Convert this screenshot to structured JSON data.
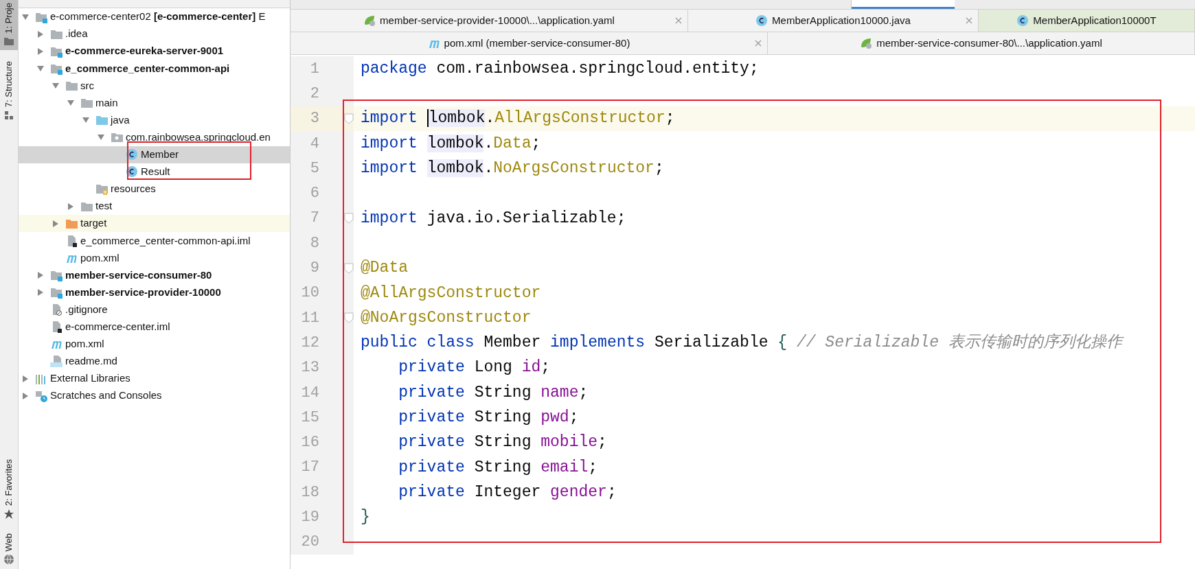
{
  "tool_stripe": [
    {
      "label": "1: Proje",
      "selected": true
    },
    {
      "label": "7: Structure",
      "selected": false
    },
    {
      "label": "2: Favorites",
      "selected": false
    },
    {
      "label": "Web",
      "selected": false
    }
  ],
  "project_tree": [
    {
      "label": "e-commerce-center02 **[e-commerce-center]** E",
      "kind": "project",
      "expanded": true,
      "selected": false,
      "children": [
        {
          "label": ".idea",
          "kind": "folder",
          "expanded": false,
          "selected": false
        },
        {
          "label": "e-commerce-eureka-server-9001",
          "kind": "module",
          "expanded": false,
          "selected": false
        },
        {
          "label": "e_commerce_center-common-api",
          "kind": "module",
          "expanded": true,
          "selected": false,
          "children": [
            {
              "label": "src",
              "kind": "folder",
              "expanded": true,
              "selected": false,
              "children": [
                {
                  "label": "main",
                  "kind": "folder",
                  "expanded": true,
                  "selected": false,
                  "children": [
                    {
                      "label": "java",
                      "kind": "source",
                      "expanded": true,
                      "selected": false,
                      "children": [
                        {
                          "label": "com.rainbowsea.springcloud.en",
                          "kind": "package",
                          "expanded": true,
                          "selected": false,
                          "children": [
                            {
                              "label": "Member",
                              "kind": "class",
                              "selected": true
                            },
                            {
                              "label": "Result",
                              "kind": "class",
                              "selected": false
                            }
                          ]
                        }
                      ]
                    },
                    {
                      "label": "resources",
                      "kind": "resources",
                      "selected": false
                    }
                  ]
                },
                {
                  "label": "test",
                  "kind": "folder",
                  "expanded": false,
                  "selected": false
                }
              ]
            },
            {
              "label": "target",
              "kind": "excluded",
              "expanded": false,
              "selected": false
            },
            {
              "label": "e_commerce_center-common-api.iml",
              "kind": "iml",
              "selected": false
            },
            {
              "label": "pom.xml",
              "kind": "maven",
              "selected": false
            }
          ]
        },
        {
          "label": "member-service-consumer-80",
          "kind": "module",
          "expanded": false,
          "selected": false
        },
        {
          "label": "member-service-provider-10000",
          "kind": "module",
          "expanded": false,
          "selected": false
        },
        {
          "label": ".gitignore",
          "kind": "gitignore",
          "selected": false
        },
        {
          "label": "e-commerce-center.iml",
          "kind": "iml",
          "selected": false
        },
        {
          "label": "pom.xml",
          "kind": "maven",
          "selected": false
        },
        {
          "label": "readme.md",
          "kind": "markdown",
          "selected": false
        }
      ]
    },
    {
      "label": "External Libraries",
      "kind": "libraries",
      "expanded": false,
      "selected": false
    },
    {
      "label": "Scratches and Consoles",
      "kind": "scratches",
      "expanded": false,
      "selected": false
    }
  ],
  "tab_rows": [
    {
      "tabs": [
        {
          "label": "member-service-provider-10000\\...\\application.yaml",
          "kind": "yaml",
          "closable": true,
          "tinted": false
        },
        {
          "label": "MemberApplication10000.java",
          "kind": "java",
          "closable": true,
          "tinted": false
        },
        {
          "label": "MemberApplication10000T",
          "kind": "java",
          "closable": false,
          "tinted": true
        }
      ]
    },
    {
      "tabs": [
        {
          "label": "pom.xml (member-service-consumer-80)",
          "kind": "maven",
          "closable": true,
          "tinted": false
        },
        {
          "label": "member-service-consumer-80\\...\\application.yaml",
          "kind": "yaml",
          "closable": false,
          "tinted": false
        }
      ]
    }
  ],
  "code": {
    "lines": [
      {
        "number": "1",
        "fold": false,
        "current": false,
        "tokens": [
          {
            "text": "package",
            "kind": "keyword"
          },
          {
            "text": " com.rainbowsea.springcloud.entity;",
            "kind": "plain"
          }
        ]
      },
      {
        "number": "2",
        "fold": false,
        "current": false
      },
      {
        "number": "3",
        "fold": true,
        "current": true,
        "tokens": [
          {
            "text": "import ",
            "kind": "keyword"
          },
          {
            "text": "lombok",
            "kind": "ref",
            "caret": true
          },
          {
            "text": ".",
            "kind": "plain"
          },
          {
            "text": "AllArgsConstructor",
            "kind": "annotation"
          },
          {
            "text": ";",
            "kind": "plain"
          }
        ]
      },
      {
        "number": "4",
        "fold": false,
        "current": false,
        "tokens": [
          {
            "text": "import ",
            "kind": "keyword"
          },
          {
            "text": "lombok",
            "kind": "ref"
          },
          {
            "text": ".",
            "kind": "plain"
          },
          {
            "text": "Data",
            "kind": "annotation"
          },
          {
            "text": ";",
            "kind": "plain"
          }
        ]
      },
      {
        "number": "5",
        "fold": false,
        "current": false,
        "tokens": [
          {
            "text": "import ",
            "kind": "keyword"
          },
          {
            "text": "lombok",
            "kind": "ref"
          },
          {
            "text": ".",
            "kind": "plain"
          },
          {
            "text": "NoArgsConstructor",
            "kind": "annotation"
          },
          {
            "text": ";",
            "kind": "plain"
          }
        ]
      },
      {
        "number": "6",
        "fold": false,
        "current": false
      },
      {
        "number": "7",
        "fold": true,
        "current": false,
        "tokens": [
          {
            "text": "import",
            "kind": "keyword"
          },
          {
            "text": " java.io.Serializable;",
            "kind": "plain"
          }
        ]
      },
      {
        "number": "8",
        "fold": false,
        "current": false
      },
      {
        "number": "9",
        "fold": true,
        "current": false,
        "tokens": [
          {
            "text": "@Data",
            "kind": "annotation"
          }
        ]
      },
      {
        "number": "10",
        "fold": false,
        "current": false,
        "tokens": [
          {
            "text": "@AllArgsConstructor",
            "kind": "annotation"
          }
        ]
      },
      {
        "number": "11",
        "fold": true,
        "current": false,
        "tokens": [
          {
            "text": "@NoArgsConstructor",
            "kind": "annotation"
          }
        ]
      },
      {
        "number": "12",
        "fold": false,
        "current": false,
        "tokens": [
          {
            "text": "public class",
            "kind": "keyword"
          },
          {
            "text": " Member ",
            "kind": "plain"
          },
          {
            "text": "implements",
            "kind": "keyword"
          },
          {
            "text": " Serializable ",
            "kind": "plain"
          },
          {
            "text": "{",
            "kind": "brace"
          },
          {
            "text": " // Serializable 表示传输时的序列化操作",
            "kind": "comment"
          }
        ]
      },
      {
        "number": "13",
        "fold": false,
        "current": false,
        "tokens": [
          {
            "text": "    private",
            "kind": "keyword"
          },
          {
            "text": " Long ",
            "kind": "plain"
          },
          {
            "text": "id",
            "kind": "field"
          },
          {
            "text": ";",
            "kind": "plain"
          }
        ]
      },
      {
        "number": "14",
        "fold": false,
        "current": false,
        "tokens": [
          {
            "text": "    private",
            "kind": "keyword"
          },
          {
            "text": " String ",
            "kind": "plain"
          },
          {
            "text": "name",
            "kind": "field"
          },
          {
            "text": ";",
            "kind": "plain"
          }
        ]
      },
      {
        "number": "15",
        "fold": false,
        "current": false,
        "tokens": [
          {
            "text": "    private",
            "kind": "keyword"
          },
          {
            "text": " String ",
            "kind": "plain"
          },
          {
            "text": "pwd",
            "kind": "field"
          },
          {
            "text": ";",
            "kind": "plain"
          }
        ]
      },
      {
        "number": "16",
        "fold": false,
        "current": false,
        "tokens": [
          {
            "text": "    private",
            "kind": "keyword"
          },
          {
            "text": " String ",
            "kind": "plain"
          },
          {
            "text": "mobile",
            "kind": "field"
          },
          {
            "text": ";",
            "kind": "plain"
          }
        ]
      },
      {
        "number": "17",
        "fold": false,
        "current": false,
        "tokens": [
          {
            "text": "    private",
            "kind": "keyword"
          },
          {
            "text": " String ",
            "kind": "plain"
          },
          {
            "text": "email",
            "kind": "field"
          },
          {
            "text": ";",
            "kind": "plain"
          }
        ]
      },
      {
        "number": "18",
        "fold": false,
        "current": false,
        "tokens": [
          {
            "text": "    private",
            "kind": "keyword"
          },
          {
            "text": " Integer ",
            "kind": "plain"
          },
          {
            "text": "gender",
            "kind": "field"
          },
          {
            "text": ";",
            "kind": "plain"
          }
        ]
      },
      {
        "number": "19",
        "fold": false,
        "current": false,
        "tokens": [
          {
            "text": "}",
            "kind": "brace"
          }
        ]
      },
      {
        "number": "20",
        "fold": false,
        "current": false
      }
    ]
  }
}
